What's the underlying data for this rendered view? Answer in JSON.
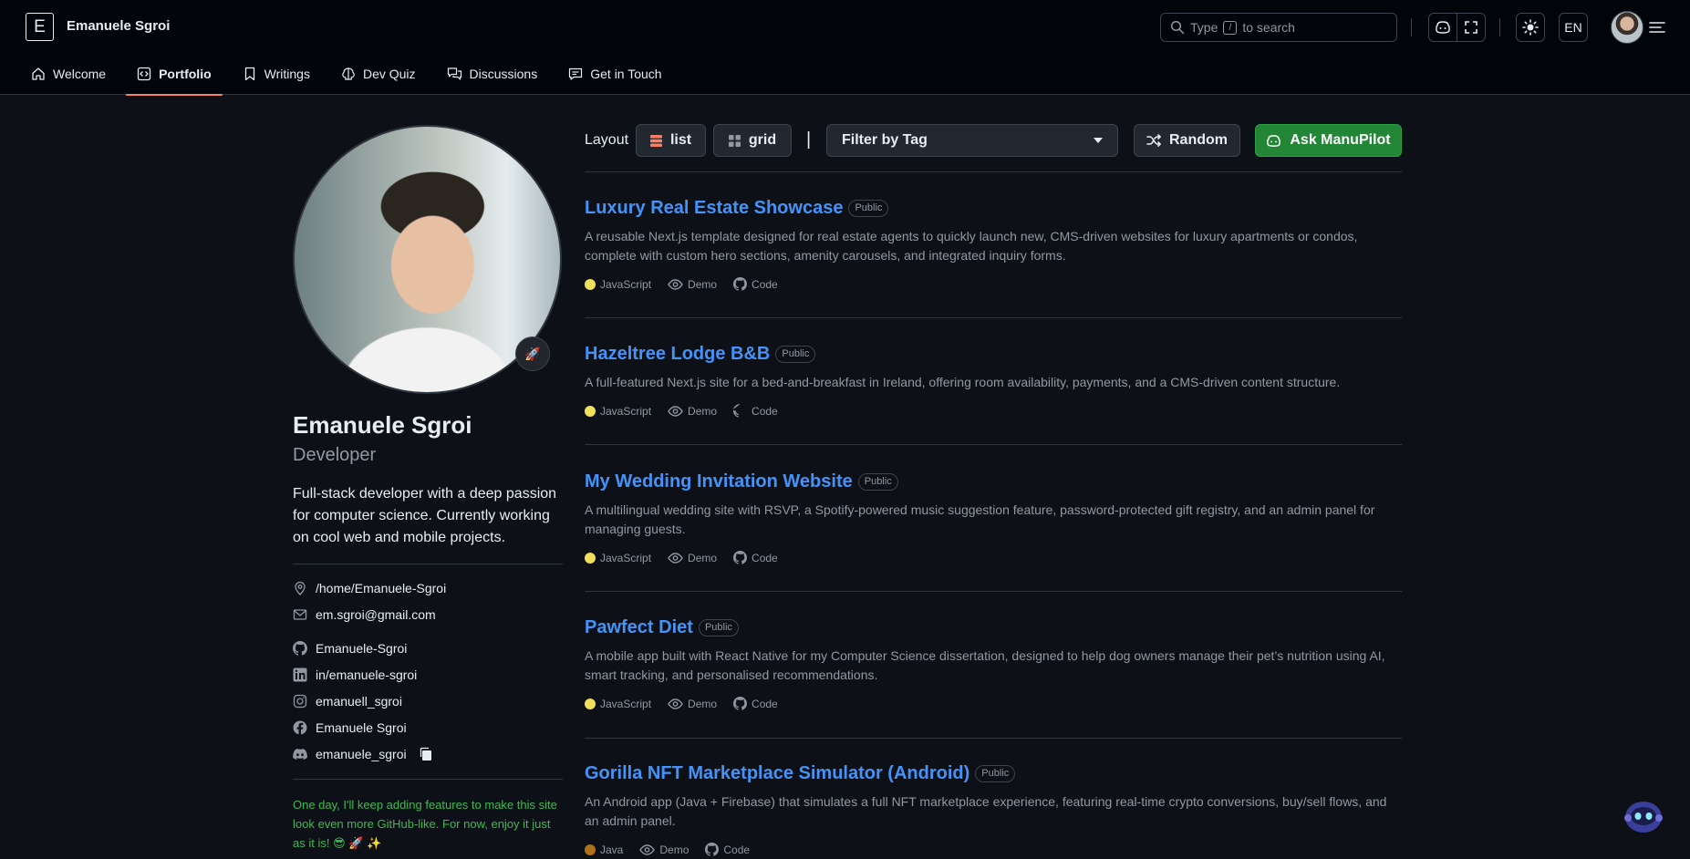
{
  "header": {
    "logo_letter": "E",
    "owner_name": "Emanuele Sgroi",
    "search": {
      "text_before": "Type",
      "key": "/",
      "text_after": "to search"
    },
    "language": "EN"
  },
  "tabs": [
    {
      "label": "Welcome",
      "icon": "home-icon"
    },
    {
      "label": "Portfolio",
      "icon": "code-square-icon",
      "active": true
    },
    {
      "label": "Writings",
      "icon": "bookmark-icon"
    },
    {
      "label": "Dev Quiz",
      "icon": "brain-icon"
    },
    {
      "label": "Discussions",
      "icon": "comment-discussion-icon"
    },
    {
      "label": "Get in Touch",
      "icon": "mail-icon"
    }
  ],
  "profile": {
    "name": "Emanuele Sgroi",
    "role": "Developer",
    "bio": "Full-stack developer with a deep passion for computer science. Currently working on cool web and mobile projects.",
    "location": "/home/Emanuele-Sgroi",
    "email": "em.sgroi@gmail.com",
    "github": "Emanuele-Sgroi",
    "linkedin": "in/emanuele-sgroi",
    "instagram": "emanuell_sgroi",
    "facebook": "Emanuele Sgroi",
    "discord": "emanuele_sgroi",
    "footer_note": "One day, I'll keep adding features to make this site look even more GitHub-like. For now, enjoy it just as it is! 😎 🚀 ✨"
  },
  "controls": {
    "layout_label": "Layout",
    "list_label": "list",
    "grid_label": "grid",
    "pipe": "|",
    "filter_label": "Filter by Tag",
    "random_label": "Random",
    "ask_label": "Ask ManuPilot"
  },
  "colors": {
    "accent_green": "#238636",
    "link_blue": "#4493f8",
    "javascript": "#f1e05a",
    "java": "#b07219",
    "tab_underline": "#f78166"
  },
  "projects": [
    {
      "title": "Luxury Real Estate Showcase",
      "visibility": "Public",
      "description": "A reusable Next.js template designed for real estate agents to quickly launch new, CMS-driven websites for luxury apartments or condos, complete with custom hero sections, amenity carousels, and integrated inquiry forms.",
      "language": "JavaScript",
      "demo_label": "Demo",
      "code_label": "Code"
    },
    {
      "title": "Hazeltree Lodge B&B",
      "visibility": "Public",
      "description": "A full-featured Next.js site for a bed-and-breakfast in Ireland, offering room availability, payments, and a CMS-driven content structure.",
      "language": "JavaScript",
      "demo_label": "Demo",
      "code_label": "Code"
    },
    {
      "title": "My Wedding Invitation Website",
      "visibility": "Public",
      "description": "A multilingual wedding site with RSVP, a Spotify-powered music suggestion feature, password-protected gift registry, and an admin panel for managing guests.",
      "language": "JavaScript",
      "demo_label": "Demo",
      "code_label": "Code"
    },
    {
      "title": "Pawfect Diet",
      "visibility": "Public",
      "description": "A mobile app built with React Native for my Computer Science dissertation, designed to help dog owners manage their pet’s nutrition using AI, smart tracking, and personalised recommendations.",
      "language": "JavaScript",
      "demo_label": "Demo",
      "code_label": "Code"
    },
    {
      "title": "Gorilla NFT Marketplace Simulator (Android)",
      "visibility": "Public",
      "description": "An Android app (Java + Firebase) that simulates a full NFT marketplace experience, featuring real-time crypto conversions, buy/sell flows, and an admin panel.",
      "language": "Java",
      "demo_label": "Demo",
      "code_label": "Code"
    }
  ]
}
